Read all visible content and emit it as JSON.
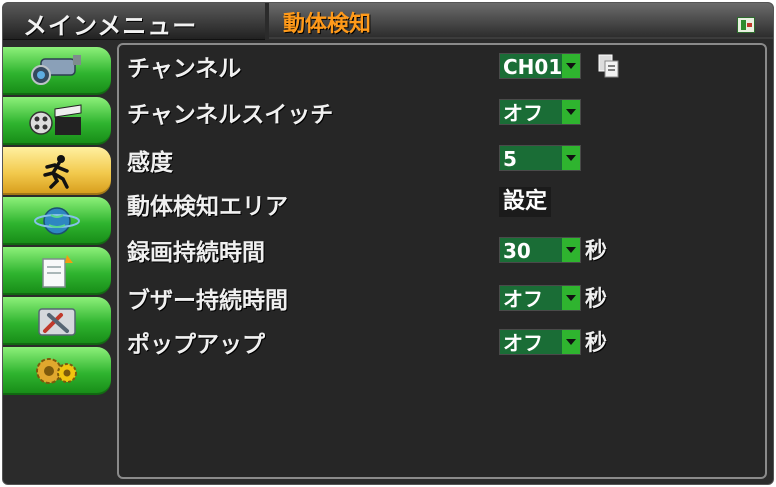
{
  "header": {
    "menu_title": "メインメニュー",
    "page_title": "動体検知",
    "exit_icon": "exit-icon"
  },
  "sidebar": {
    "items": [
      {
        "name": "camera",
        "icon": "camera-icon"
      },
      {
        "name": "record",
        "icon": "film-clapper-icon"
      },
      {
        "name": "motion",
        "icon": "running-man-icon",
        "active": true
      },
      {
        "name": "network",
        "icon": "globe-network-icon"
      },
      {
        "name": "alarm",
        "icon": "document-alert-icon"
      },
      {
        "name": "device",
        "icon": "tools-icon"
      },
      {
        "name": "system",
        "icon": "gears-icon"
      }
    ]
  },
  "settings": {
    "channel": {
      "label": "チャンネル",
      "value": "CH01",
      "copy_icon": "copy-icon"
    },
    "channel_switch": {
      "label": "チャンネルスイッチ",
      "value": "オフ"
    },
    "sensitivity": {
      "label": "感度",
      "value": "5"
    },
    "motion_area": {
      "label": "動体検知エリア",
      "button": "設定"
    },
    "record_duration": {
      "label": "録画持続時間",
      "value": "30",
      "unit": "秒"
    },
    "buzzer_duration": {
      "label": "ブザー持続時間",
      "value": "オフ",
      "unit": "秒"
    },
    "popup": {
      "label": "ポップアップ",
      "value": "オフ",
      "unit": "秒"
    }
  },
  "colors": {
    "title_accent": "#ff9a1a",
    "sidebar_green": "#2fb42f",
    "sidebar_active": "#f2c94c",
    "dropdown_bg": "#1a6d36",
    "panel_bg": "#262626"
  }
}
